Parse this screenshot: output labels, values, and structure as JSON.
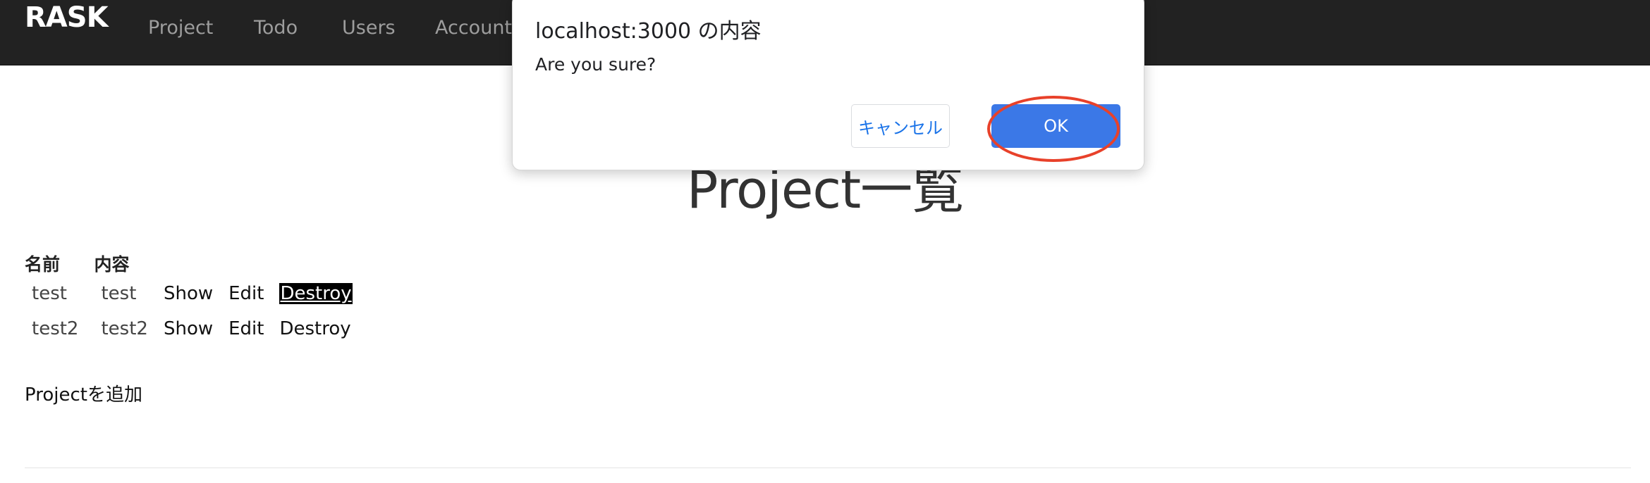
{
  "navbar": {
    "brand": "RASK",
    "items": [
      {
        "label": "Project"
      },
      {
        "label": "Todo"
      },
      {
        "label": "Users"
      },
      {
        "label": "Account"
      }
    ]
  },
  "page": {
    "title": "Project一覧",
    "table": {
      "headers": [
        "名前",
        "内容"
      ],
      "rows": [
        {
          "name": "test",
          "content": "test",
          "show": "Show",
          "edit": "Edit",
          "destroy": "Destroy"
        },
        {
          "name": "test2",
          "content": "test2",
          "show": "Show",
          "edit": "Edit",
          "destroy": "Destroy"
        }
      ]
    },
    "add_link": "Projectを追加"
  },
  "dialog": {
    "title": "localhost:3000 の内容",
    "message": "Are you sure?",
    "cancel_label": "キャンセル",
    "ok_label": "OK"
  },
  "colors": {
    "navbar_bg": "#222222",
    "nav_text": "#9d9d9d",
    "ok_button": "#3b78e7",
    "highlight": "#e8412a"
  }
}
